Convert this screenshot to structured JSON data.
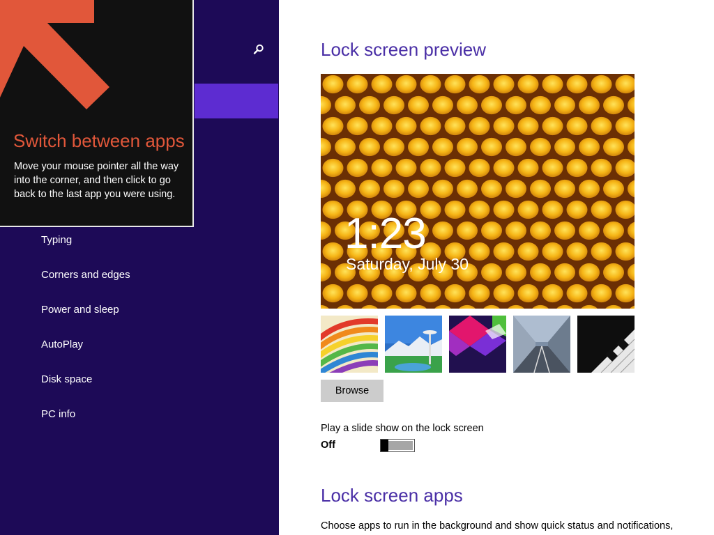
{
  "sidebar": {
    "search_icon": "search-icon",
    "items": [
      {
        "label": "Typing"
      },
      {
        "label": "Corners and edges"
      },
      {
        "label": "Power and sleep"
      },
      {
        "label": "AutoPlay"
      },
      {
        "label": "Disk space"
      },
      {
        "label": "PC info"
      }
    ]
  },
  "tip": {
    "title": "Switch between apps",
    "body": "Move your mouse pointer all the way into the corner, and then click to go back to the last app you were using."
  },
  "main": {
    "preview_title": "Lock screen preview",
    "preview_time": "1:23",
    "preview_date": "Saturday, July 30",
    "thumbnails": [
      "colorful-ribbons",
      "space-needle",
      "geometric-shapes",
      "train-tunnel",
      "piano-keys"
    ],
    "browse_label": "Browse",
    "slideshow_label": "Play a slide show on the lock screen",
    "slideshow_state": "Off",
    "apps_title": "Lock screen apps",
    "apps_description": "Choose apps to run in the background and show quick status and notifications,"
  },
  "colors": {
    "sidebar_bg": "#1d0a57",
    "selected": "#5d2cd1",
    "accent": "#4a2fa6",
    "tip_title": "#e1573a"
  }
}
